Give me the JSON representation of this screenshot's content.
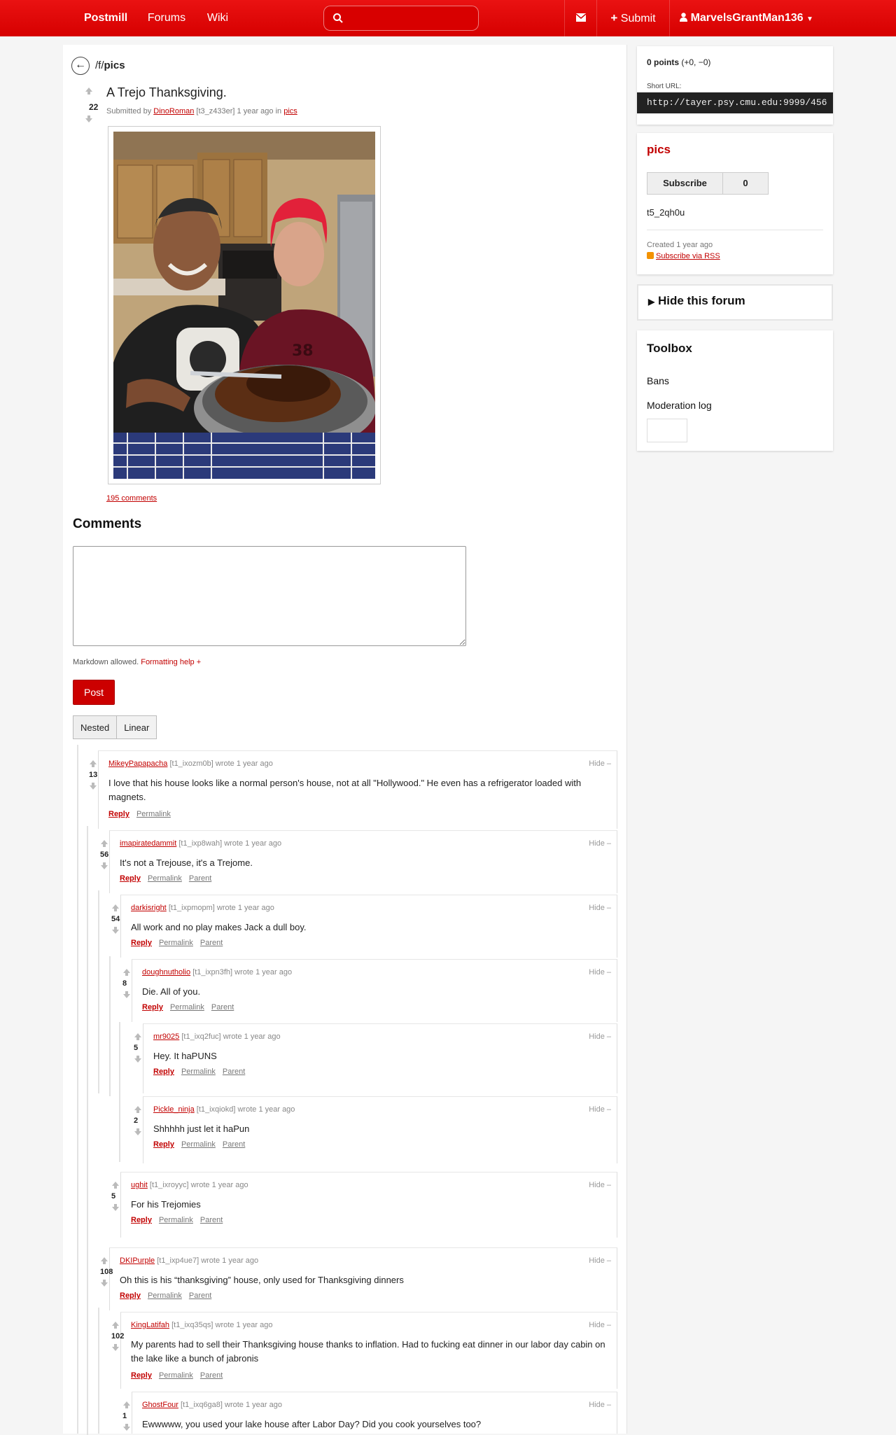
{
  "nav": {
    "brand": "Postmill",
    "forums": "Forums",
    "wiki": "Wiki",
    "search_value": "",
    "submit": "Submit",
    "user": "MarvelsGrantMan136"
  },
  "post": {
    "back_prefix": "/f/",
    "back_forum": "pics",
    "score": "22",
    "title": "A Trejo Thanksgiving.",
    "submitted_by": "Submitted by",
    "author": "DinoRoman",
    "author_id": "[t3_z433er]",
    "time": "1 year ago in",
    "forum": "pics",
    "comments_link": "195 comments"
  },
  "comments_section": {
    "heading": "Comments",
    "markdown_note": "Markdown allowed.",
    "formatting_help": "Formatting help +",
    "post_button": "Post",
    "view_nested": "Nested",
    "view_linear": "Linear"
  },
  "comment_actions": {
    "reply": "Reply",
    "permalink": "Permalink",
    "parent": "Parent",
    "hide": "Hide –",
    "wrote": "wrote 1 year ago"
  },
  "comments": [
    {
      "author": "MikeyPapapacha",
      "id": "[t1_ixozm0b]",
      "score": "13",
      "body": "I love that his house looks like a normal person's house, not at all \"Hollywood.\" He even has a refrigerator loaded with magnets."
    },
    {
      "author": "imapiratedammit",
      "id": "[t1_ixp8wah]",
      "score": "56",
      "body": "It's not a Trejouse, it's a Trejome."
    },
    {
      "author": "darkisright",
      "id": "[t1_ixpmopm]",
      "score": "54",
      "body": "All work and no play makes Jack a dull boy."
    },
    {
      "author": "doughnutholio",
      "id": "[t1_ixpn3fh]",
      "score": "8",
      "body": "Die. All of you."
    },
    {
      "author": "mr9025",
      "id": "[t1_ixq2fuc]",
      "score": "5",
      "body": "Hey. It haPUNS"
    },
    {
      "author": "Pickle_ninja",
      "id": "[t1_ixqiokd]",
      "score": "2",
      "body": "Shhhhh just let it haPun"
    },
    {
      "author": "ughit",
      "id": "[t1_ixroyyc]",
      "score": "5",
      "body": "For his Trejomies"
    },
    {
      "author": "DKIPurple",
      "id": "[t1_ixp4ue7]",
      "score": "108",
      "body": "Oh this is his “thanksgiving” house, only used for Thanksgiving dinners"
    },
    {
      "author": "KingLatifah",
      "id": "[t1_ixq35qs]",
      "score": "102",
      "body": "My parents had to sell their Thanksgiving house thanks to inflation. Had to fucking eat dinner in our labor day cabin on the lake like a bunch of jabronis"
    },
    {
      "author": "GhostFour",
      "id": "[t1_ixq6ga8]",
      "score": "1",
      "body": "Ewwwww, you used your lake house after Labor Day? Did you cook yourselves too?"
    }
  ],
  "sidebar": {
    "points": "0 points",
    "points_detail": "(+0, −0)",
    "short_url_label": "Short URL:",
    "short_url": "http://tayer.psy.cmu.edu:9999/456",
    "forum_name": "pics",
    "subscribe": "Subscribe",
    "subscriber_count": "0",
    "forum_id": "t5_2qh0u",
    "created": "Created 1 year ago",
    "rss": "Subscribe via RSS",
    "hide_forum": "Hide this forum",
    "toolbox_title": "Toolbox",
    "toolbox_bans": "Bans",
    "toolbox_modlog": "Moderation log"
  },
  "colors": {
    "accent": "#e00000",
    "link": "#c20000"
  }
}
